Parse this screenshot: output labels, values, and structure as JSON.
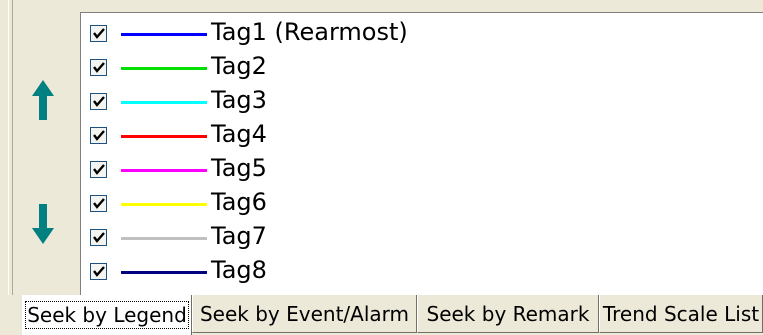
{
  "legend": {
    "items": [
      {
        "label": "Tag1 (Rearmost)",
        "checked": true,
        "color": "#0000ff"
      },
      {
        "label": "Tag2",
        "checked": true,
        "color": "#00e000"
      },
      {
        "label": "Tag3",
        "checked": true,
        "color": "#00ffff"
      },
      {
        "label": "Tag4",
        "checked": true,
        "color": "#ff0000"
      },
      {
        "label": "Tag5",
        "checked": true,
        "color": "#ff00ff"
      },
      {
        "label": "Tag6",
        "checked": true,
        "color": "#ffff00"
      },
      {
        "label": "Tag7",
        "checked": true,
        "color": "#c0c0c0"
      },
      {
        "label": "Tag8",
        "checked": true,
        "color": "#000080"
      }
    ]
  },
  "controls": {
    "move_up_icon": "arrow-up",
    "move_down_icon": "arrow-down",
    "arrow_color": "#008080"
  },
  "tabs": [
    {
      "label": "Seek by Legend",
      "active": true
    },
    {
      "label": "Seek by Event/Alarm",
      "active": false
    },
    {
      "label": "Seek by Remark",
      "active": false
    },
    {
      "label": "Trend Scale List",
      "active": false
    }
  ]
}
